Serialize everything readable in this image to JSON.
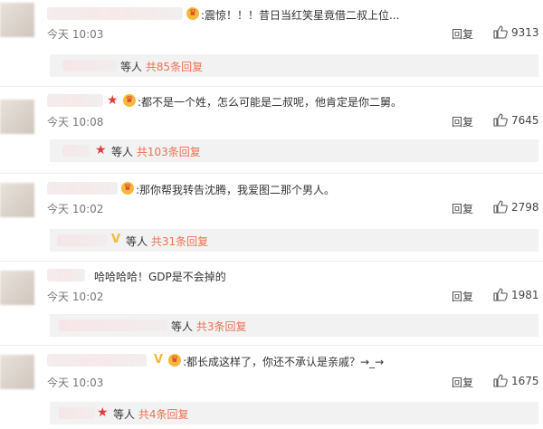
{
  "comments": [
    {
      "content": ":震惊！！！昔日当红笑星竟借二叔上位...",
      "time": "今天 10:03",
      "reply_label": "回复",
      "likes": "9313",
      "sub": {
        "others": "等人",
        "link": "共85条回复"
      },
      "badges": [
        "vip"
      ]
    },
    {
      "content": ":都不是一个姓，怎么可能是二叔呢，他肯定是你二舅。",
      "time": "今天 10:08",
      "reply_label": "回复",
      "likes": "7645",
      "sub": {
        "others": "等人",
        "link": "共103条回复"
      },
      "badges": [
        "red-star",
        "vip"
      ]
    },
    {
      "content": ":那你帮我转告沈腾，我爱图二那个男人。",
      "time": "今天 10:02",
      "reply_label": "回复",
      "likes": "2798",
      "sub": {
        "others": "等人",
        "link": "共31条回复"
      },
      "badges": [
        "vip"
      ]
    },
    {
      "content": "哈哈哈哈！GDP是不会掉的",
      "time": "今天 10:02",
      "reply_label": "回复",
      "likes": "1981",
      "sub": {
        "others": "等人",
        "link": "共3条回复"
      },
      "badges": []
    },
    {
      "content": ":都长成这样了，你还不承认是亲戚？→_→",
      "time": "今天 10:03",
      "reply_label": "回复",
      "likes": "1675",
      "sub": {
        "others": "等人",
        "link": "共4条回复"
      },
      "badges": [
        "v",
        "vip"
      ]
    }
  ],
  "colors": {
    "link": "#eb7350",
    "sub_bg": "#f2f2f2",
    "vip": "#f6b83a",
    "star": "#e23b3b"
  },
  "icons": {
    "like": "thumbs-up-icon",
    "vip": "vip-crown-icon",
    "star": "red-star-icon",
    "v": "v-badge-icon"
  }
}
